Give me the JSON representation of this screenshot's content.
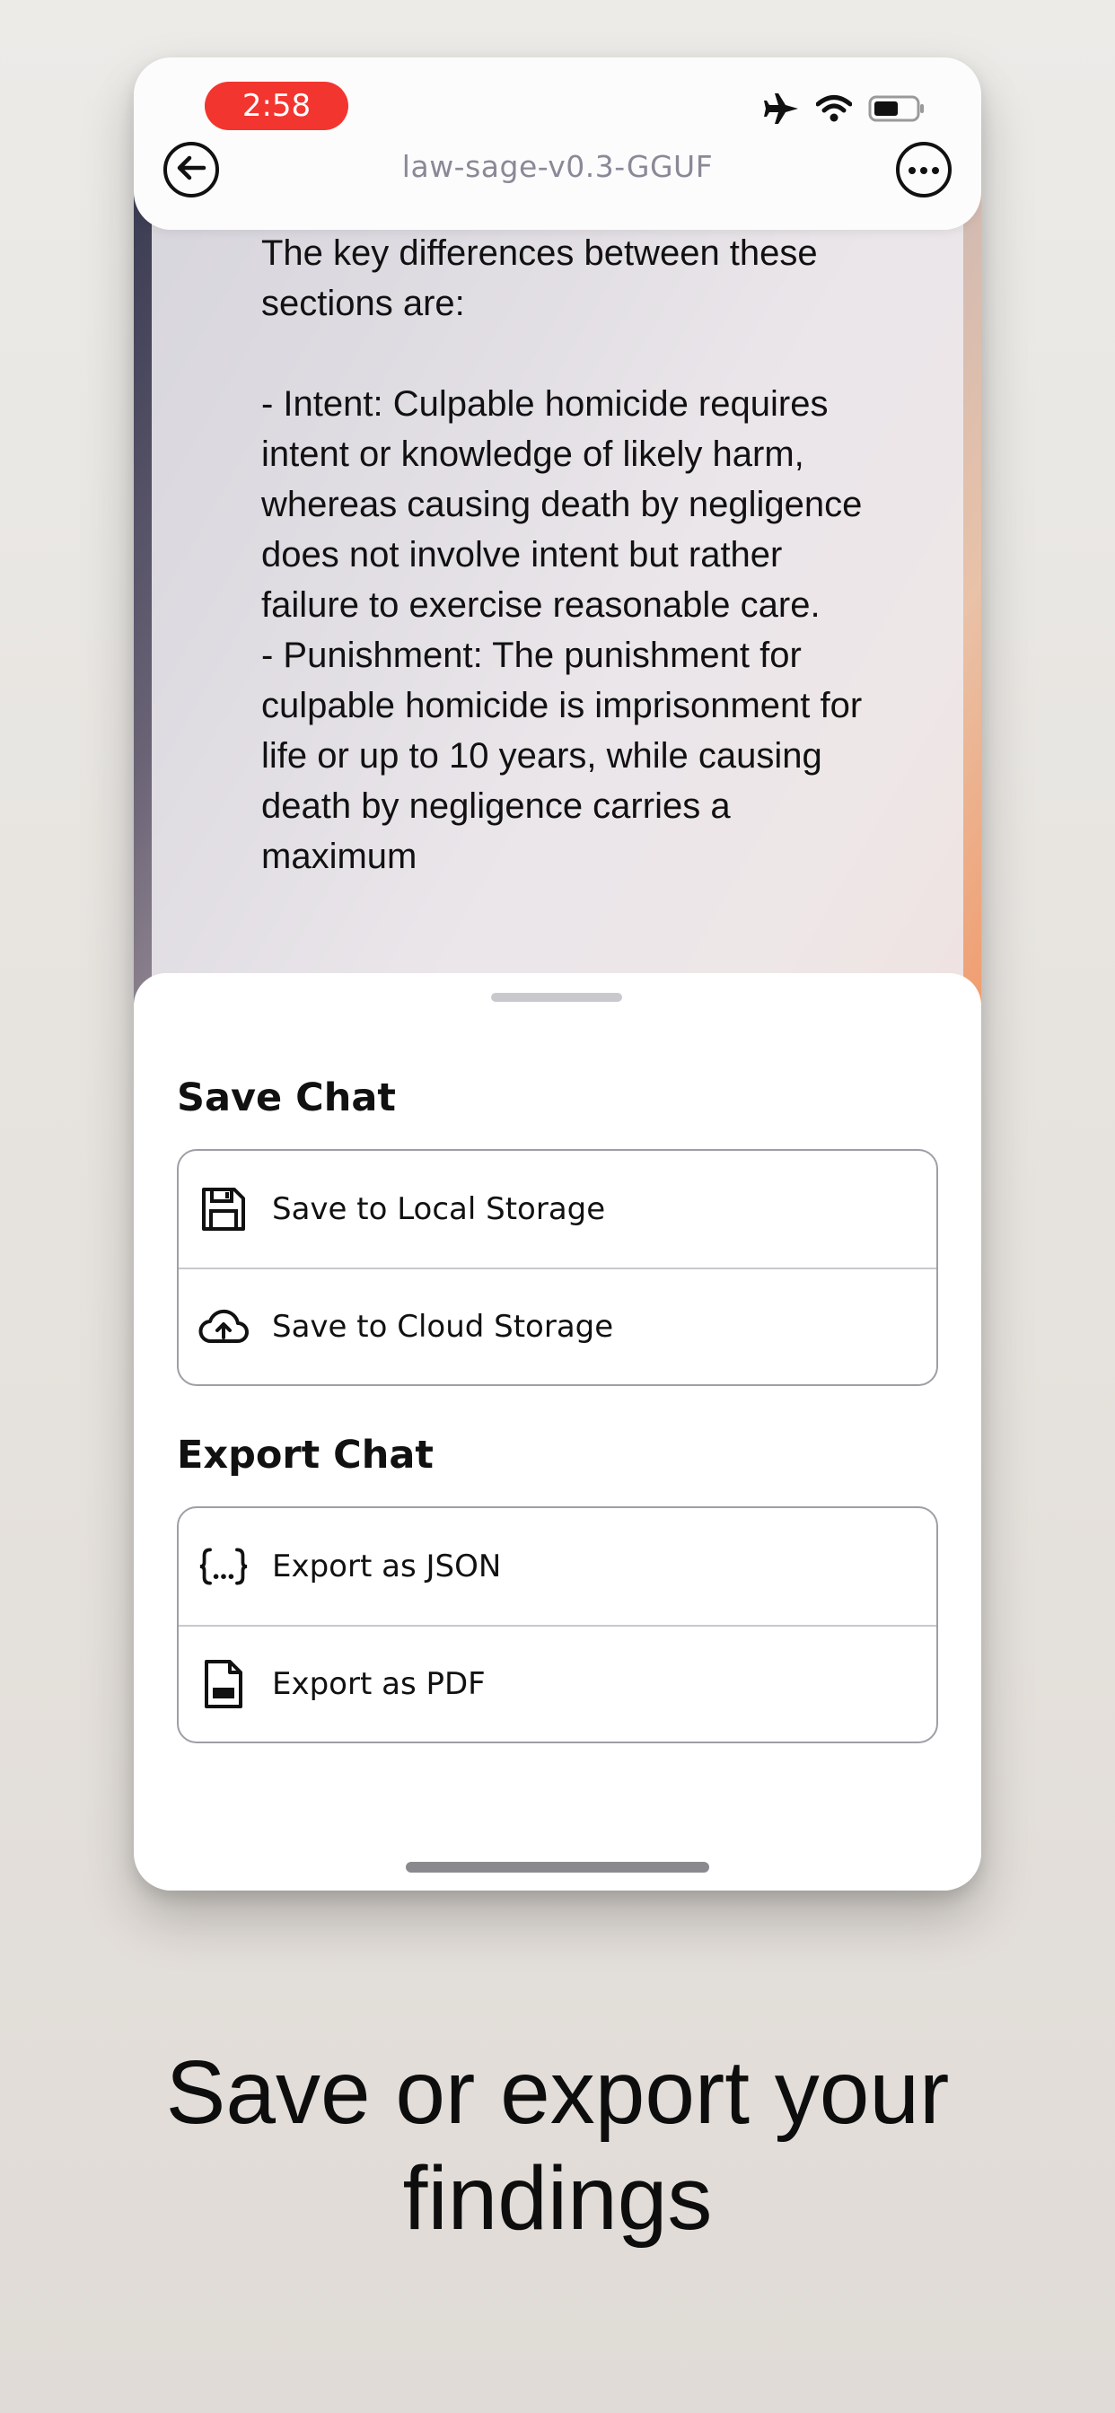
{
  "status_bar": {
    "time": "2:58",
    "icons": [
      "airplane-icon",
      "wifi-icon",
      "battery-icon"
    ]
  },
  "header": {
    "model_title": "law-sage-v0.3-GGUF",
    "back_icon": "back-arrow-icon",
    "more_icon": "more-dots-icon"
  },
  "chat": {
    "message": "The key differences between these sections are:\n\n- Intent: Culpable homicide requires intent or knowledge of likely harm, whereas causing death by negligence does not involve intent but rather failure to exercise reasonable care.\n- Punishment: The punishment for culpable homicide is imprisonment for life or up to 10 years, while causing death by negligence carries a maximum"
  },
  "sheet": {
    "save_title": "Save Chat",
    "save_items": [
      {
        "label": "Save to Local Storage",
        "icon": "floppy-disk-icon"
      },
      {
        "label": "Save to Cloud Storage",
        "icon": "cloud-upload-icon"
      }
    ],
    "export_title": "Export Chat",
    "export_items": [
      {
        "label": "Export as JSON",
        "icon": "json-braces-icon"
      },
      {
        "label": "Export as PDF",
        "icon": "pdf-file-icon"
      }
    ]
  },
  "caption": {
    "line1": "Save or export your",
    "line2": "findings"
  }
}
